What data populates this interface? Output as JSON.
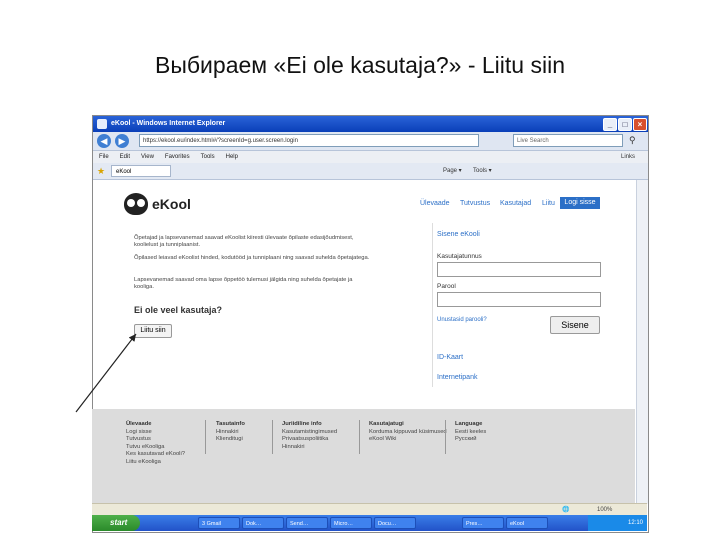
{
  "slide": {
    "title": "Выбираем «Ei ole kasutaja?» - Liitu siin"
  },
  "browser": {
    "window_title": "eKool - Windows Internet Explorer",
    "address": "https://ekool.eu/index.html#/?screenId=g.user.screen.login",
    "search_placeholder": "Live Search",
    "menu": [
      "File",
      "Edit",
      "View",
      "Favorites",
      "Tools",
      "Help"
    ],
    "links_label": "Links",
    "tab_label": "eKool",
    "commands": [
      "Page ▾",
      "Tools ▾"
    ],
    "status": "",
    "zoom": "100%"
  },
  "page": {
    "logo": "eKool",
    "nav": [
      "Ülevaade",
      "Tutvustus",
      "Kasutajad",
      "Liitu"
    ],
    "login_nav_button": "Logi sisse",
    "paragraphs": [
      "Õpetajad ja lapsevanemad saavad eKoolist kiiresti ülevaate õpilaste edasijõudmisest, koolielust ja tunniplaanist.",
      "Õpilased leiavad eKoolist hinded, kodutööd ja tunniplaani ning saavad suhelda õpetajatega.",
      "Lapsevanemad saavad oma lapse õppetöö tulemusi jälgida ning suhelda õpetajate ja kooliga."
    ],
    "question": "Ei ole veel kasutaja?",
    "join_button": "Liitu siin",
    "login_box": {
      "title": "Sisene eKooli",
      "username_label": "Kasutajatunnus",
      "password_label": "Parool",
      "forgot_link": "Unustasid parooli?",
      "submit": "Sisene",
      "id_card": "ID-Kaart",
      "bank": "Internetipank"
    },
    "footer": [
      {
        "head": "Ülevaade",
        "items": [
          "Logi sisse",
          "Tutvustus",
          "Tutvu eKooliga",
          "Kes kasutavad eKooli?",
          "Liitu eKooliga"
        ]
      },
      {
        "head": "Tasutainfo",
        "items": [
          "Hinnakiri",
          "Klienditugi"
        ]
      },
      {
        "head": "Juriidiline info",
        "items": [
          "Kasutamistingimused",
          "Privaatsuspoliitika",
          "Hinnakiri"
        ]
      },
      {
        "head": "Kasutajatugi",
        "items": [
          "Korduma kippuvad küsimused",
          "eKool Wiki"
        ]
      },
      {
        "head": "Language",
        "items": [
          "Eesti keeles",
          "Русский"
        ]
      }
    ]
  },
  "taskbar": {
    "start": "start",
    "items": [
      "3 Gmail",
      "Dok…",
      "Send…",
      "Micro…",
      "Docu…",
      "Pres…",
      "eKool"
    ],
    "tray_time": "12:10"
  },
  "colors": {
    "accent": "#2b6fc7",
    "xp_blue": "#2252c8"
  }
}
